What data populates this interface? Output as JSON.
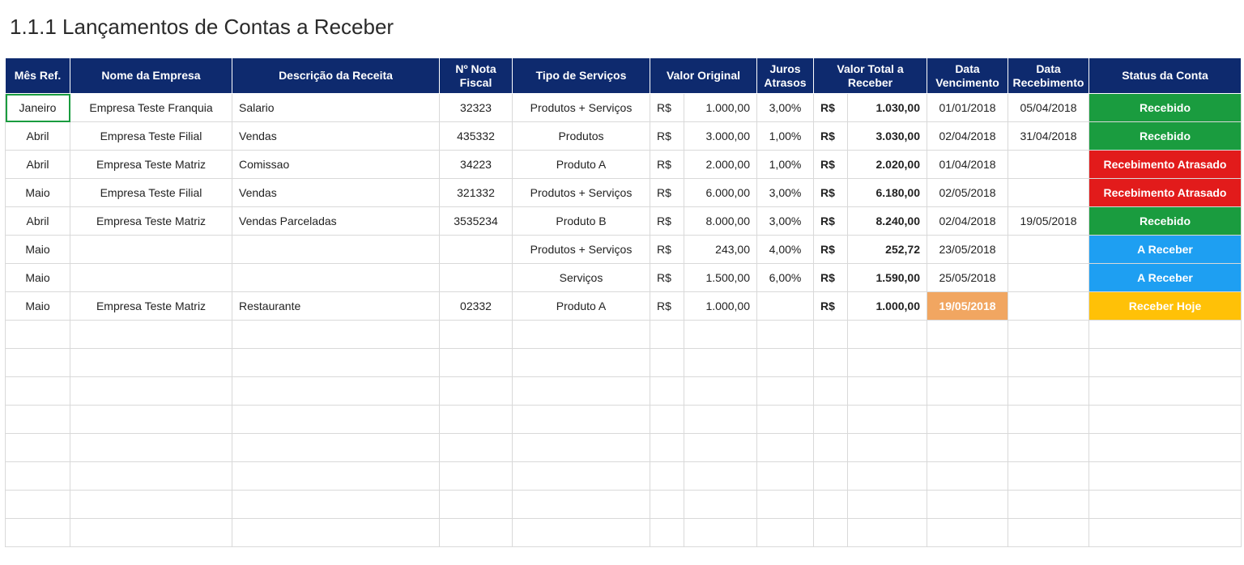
{
  "title": "1.1.1 Lançamentos de Contas a Receber",
  "headers": {
    "mes": "Mês Ref.",
    "empresa": "Nome da Empresa",
    "descricao": "Descrição da Receita",
    "nota1": "Nº Nota",
    "nota2": "Fiscal",
    "tipo": "Tipo de Serviços",
    "valor": "Valor Original",
    "juros1": "Juros",
    "juros2": "Atrasos",
    "total1": "Valor Total a",
    "total2": "Receber",
    "venc1": "Data",
    "venc2": "Vencimento",
    "rec1": "Data",
    "rec2": "Recebimento",
    "status": "Status da Conta"
  },
  "currency": "R$",
  "statusLabels": {
    "recebido": "Recebido",
    "atrasado": "Recebimento Atrasado",
    "areceber": "A Receber",
    "hoje": "Receber Hoje"
  },
  "rows": [
    {
      "mes": "Janeiro",
      "empresa": "Empresa Teste Franquia",
      "descricao": "Salario",
      "nota": "32323",
      "tipo": "Produtos + Serviços",
      "valor": "1.000,00",
      "juros": "3,00%",
      "total": "1.030,00",
      "venc": "01/01/2018",
      "rec": "05/04/2018",
      "status": "recebido",
      "sel": true
    },
    {
      "mes": "Abril",
      "empresa": "Empresa Teste Filial",
      "descricao": "Vendas",
      "nota": "435332",
      "tipo": "Produtos",
      "valor": "3.000,00",
      "juros": "1,00%",
      "total": "3.030,00",
      "venc": "02/04/2018",
      "rec": "31/04/2018",
      "status": "recebido"
    },
    {
      "mes": "Abril",
      "empresa": "Empresa Teste Matriz",
      "descricao": "Comissao",
      "nota": "34223",
      "tipo": "Produto A",
      "valor": "2.000,00",
      "juros": "1,00%",
      "total": "2.020,00",
      "venc": "01/04/2018",
      "rec": "",
      "status": "atrasado"
    },
    {
      "mes": "Maio",
      "empresa": "Empresa Teste Filial",
      "descricao": "Vendas",
      "nota": "321332",
      "tipo": "Produtos + Serviços",
      "valor": "6.000,00",
      "juros": "3,00%",
      "total": "6.180,00",
      "venc": "02/05/2018",
      "rec": "",
      "status": "atrasado"
    },
    {
      "mes": "Abril",
      "empresa": "Empresa Teste Matriz",
      "descricao": "Vendas Parceladas",
      "nota": "3535234",
      "tipo": "Produto B",
      "valor": "8.000,00",
      "juros": "3,00%",
      "total": "8.240,00",
      "venc": "02/04/2018",
      "rec": "19/05/2018",
      "status": "recebido"
    },
    {
      "mes": "Maio",
      "empresa": "",
      "descricao": "",
      "nota": "",
      "tipo": "Produtos + Serviços",
      "valor": "243,00",
      "juros": "4,00%",
      "total": "252,72",
      "venc": "23/05/2018",
      "rec": "",
      "status": "areceber"
    },
    {
      "mes": "Maio",
      "empresa": "",
      "descricao": "",
      "nota": "",
      "tipo": "Serviços",
      "valor": "1.500,00",
      "juros": "6,00%",
      "total": "1.590,00",
      "venc": "25/05/2018",
      "rec": "",
      "status": "areceber"
    },
    {
      "mes": "Maio",
      "empresa": "Empresa Teste Matriz",
      "descricao": "Restaurante",
      "nota": "02332",
      "tipo": "Produto A",
      "valor": "1.000,00",
      "juros": "",
      "total": "1.000,00",
      "venc": "19/05/2018",
      "rec": "",
      "status": "hoje",
      "hlVenc": true
    }
  ],
  "emptyRows": 8
}
